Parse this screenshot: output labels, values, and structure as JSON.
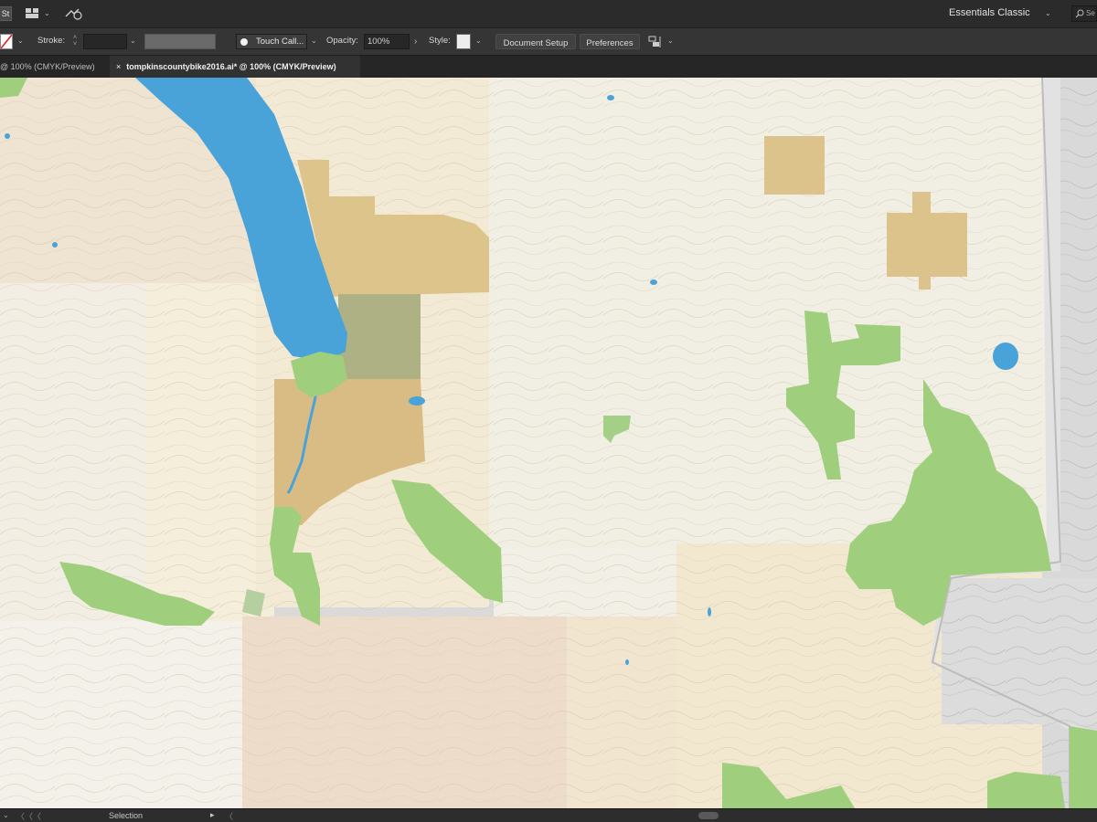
{
  "menubar": {
    "app_badge": "St",
    "workspace": "Essentials Classic",
    "search_text": "Se"
  },
  "controlbar": {
    "stroke_label": "Stroke:",
    "brush_name": "Touch Call...",
    "opacity_label": "Opacity:",
    "opacity_value": "100%",
    "style_label": "Style:",
    "document_setup": "Document Setup",
    "preferences": "Preferences"
  },
  "tabs": [
    {
      "label": "@ 100% (CMYK/Preview)",
      "close": ""
    },
    {
      "label": "tompkinscountybike2016.ai* @ 100% (CMYK/Preview)",
      "close": "×"
    }
  ],
  "statusbar": {
    "tool": "Selection"
  },
  "colors": {
    "lake": "#4aa3d8",
    "forest": "#9fcf7c",
    "parcel_tan": "#d9bf80",
    "parcel_olive": "#a8ae80",
    "terrain_cream": "#f1ebdd",
    "terrain_beige": "#ede0c6"
  },
  "icons": [
    "arrange-documents-icon",
    "gpu-performance-icon",
    "search-icon",
    "stroke-color-icon",
    "brush-dot-icon",
    "arrange-icon"
  ]
}
